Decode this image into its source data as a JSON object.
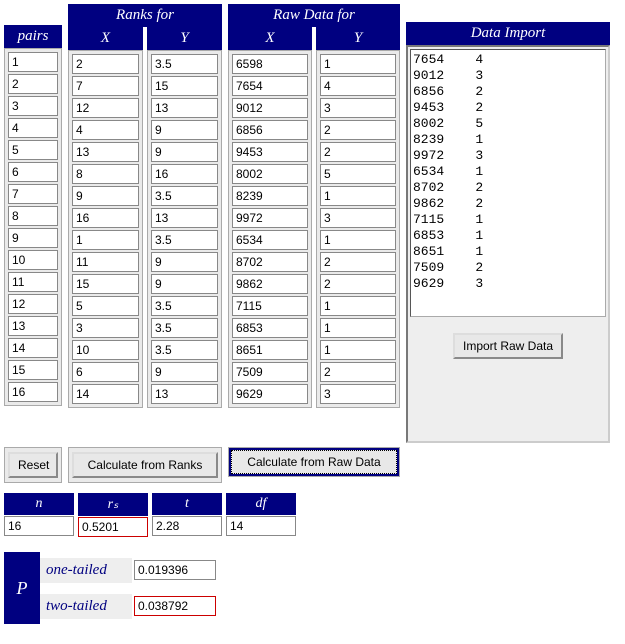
{
  "headers": {
    "pairs": "pairs",
    "ranks_for": "Ranks for",
    "ranks_x": "X",
    "ranks_y": "Y",
    "raw_for": "Raw Data for",
    "raw_x": "X",
    "raw_y": "Y",
    "import": "Data Import"
  },
  "pairs": [
    "1",
    "2",
    "3",
    "4",
    "5",
    "6",
    "7",
    "8",
    "9",
    "10",
    "11",
    "12",
    "13",
    "14",
    "15",
    "16"
  ],
  "ranks_x": [
    "2",
    "7",
    "12",
    "4",
    "13",
    "8",
    "9",
    "16",
    "1",
    "11",
    "15",
    "5",
    "3",
    "10",
    "6",
    "14"
  ],
  "ranks_y": [
    "3.5",
    "15",
    "13",
    "9",
    "9",
    "16",
    "3.5",
    "13",
    "3.5",
    "9",
    "9",
    "3.5",
    "3.5",
    "3.5",
    "9",
    "13"
  ],
  "raw_x": [
    "6598",
    "7654",
    "9012",
    "6856",
    "9453",
    "8002",
    "8239",
    "9972",
    "6534",
    "8702",
    "9862",
    "7115",
    "6853",
    "8651",
    "7509",
    "9629"
  ],
  "raw_y": [
    "1",
    "4",
    "3",
    "2",
    "2",
    "5",
    "1",
    "3",
    "1",
    "2",
    "2",
    "1",
    "1",
    "1",
    "2",
    "3"
  ],
  "import_text": "7654    4\n9012    3\n6856    2\n9453    2\n8002    5\n8239    1\n9972    3\n6534    1\n8702    2\n9862    2\n7115    1\n6853    1\n8651    1\n7509    2\n9629    3",
  "buttons": {
    "reset": "Reset",
    "calc_ranks": "Calculate from Ranks",
    "calc_raw": "Calculate from Raw Data",
    "import_raw": "Import Raw Data"
  },
  "stats": {
    "n_label": "n",
    "rs_label": "rₛ",
    "t_label": "t",
    "df_label": "df",
    "n": "16",
    "rs": "0.5201",
    "t": "2.28",
    "df": "14"
  },
  "p": {
    "label": "P",
    "one_tail_label": "one-tailed",
    "two_tail_label": "two-tailed",
    "one": "0.019396",
    "two": "0.038792"
  }
}
